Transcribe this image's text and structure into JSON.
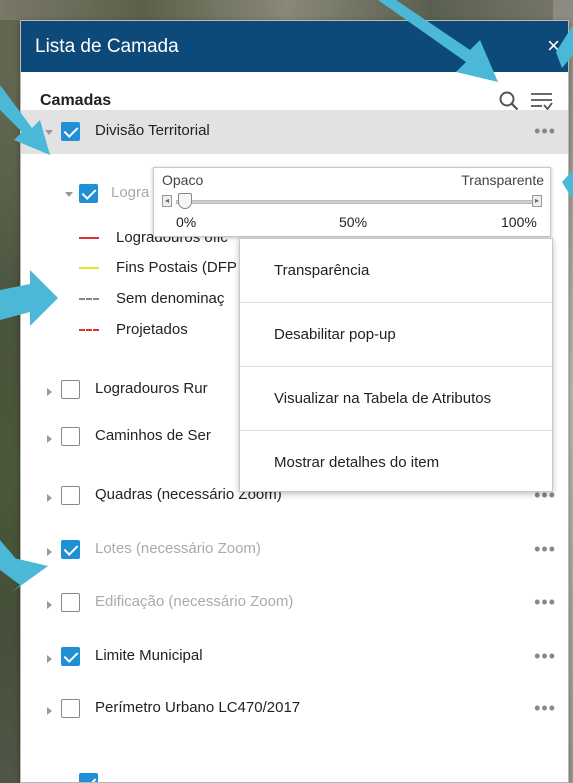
{
  "panel": {
    "title": "Lista de Camada",
    "close_icon": "×",
    "subtitle": "Camadas"
  },
  "layers": [
    {
      "label": "Divisão Territorial",
      "checked": true,
      "expanded": true,
      "dim": false
    },
    {
      "label": "Logra",
      "checked": true,
      "expanded": true,
      "dim": true
    },
    {
      "label": "Logradouros Rur",
      "checked": false,
      "expanded": false,
      "dim": false
    },
    {
      "label": "Caminhos de Ser",
      "checked": false,
      "expanded": false,
      "dim": false
    },
    {
      "label": "Quadras (necessário Zoom)",
      "checked": false,
      "expanded": false,
      "dim": false
    },
    {
      "label": "Lotes (necessário Zoom)",
      "checked": true,
      "expanded": false,
      "dim": true
    },
    {
      "label": "Edificação (necessário Zoom)",
      "checked": false,
      "expanded": false,
      "dim": true
    },
    {
      "label": "Limite Municipal",
      "checked": true,
      "expanded": false,
      "dim": false
    },
    {
      "label": "Perímetro Urbano LC470/2017",
      "checked": false,
      "expanded": false,
      "dim": false
    }
  ],
  "legend": [
    {
      "label": "Logradouros ofic",
      "color": "#e03030",
      "style": "solid"
    },
    {
      "label": "Fins Postais (DFP",
      "color": "#f0e020",
      "style": "solid"
    },
    {
      "label": "Sem denominaç",
      "color": "#888888",
      "style": "dash"
    },
    {
      "label": "Projetados",
      "color": "#e03030",
      "style": "dash"
    }
  ],
  "transparency": {
    "left_label": "Opaco",
    "right_label": "Transparente",
    "tick_0": "0%",
    "tick_50": "50%",
    "tick_100": "100%",
    "value": 0
  },
  "context_menu": {
    "items": [
      "Transparência",
      "Desabilitar pop-up",
      "Visualizar na Tabela de Atributos",
      "Mostrar detalhes do item"
    ]
  },
  "dots": "•••",
  "colors": {
    "header_bg": "#0d4a7a",
    "checkbox_on": "#1f8fd6",
    "annotation_arrow": "#4ab8d6"
  },
  "icons": {
    "search": "search-icon",
    "filter": "filter-icon"
  }
}
